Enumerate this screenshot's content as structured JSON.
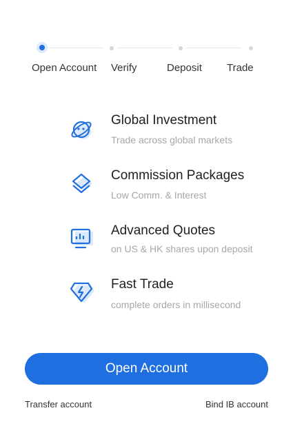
{
  "steps": [
    {
      "label": "Open Account",
      "active": true
    },
    {
      "label": "Verify",
      "active": false
    },
    {
      "label": "Deposit",
      "active": false
    },
    {
      "label": "Trade",
      "active": false
    }
  ],
  "features": [
    {
      "icon": "globe-icon",
      "title": "Global Investment",
      "desc": "Trade across global markets"
    },
    {
      "icon": "layers-icon",
      "title": "Commission Packages",
      "desc": "Low Comm. & Interest"
    },
    {
      "icon": "chart-monitor-icon",
      "title": "Advanced Quotes",
      "desc": "on US & HK shares upon deposit"
    },
    {
      "icon": "lightning-diamond-icon",
      "title": "Fast Trade",
      "desc": "complete orders in millisecond"
    }
  ],
  "cta": {
    "label": "Open Account"
  },
  "links": {
    "transfer": "Transfer account",
    "bind": "Bind IB account"
  },
  "colors": {
    "accent": "#1f6fe0",
    "icon_light": "#dbe9fb"
  }
}
